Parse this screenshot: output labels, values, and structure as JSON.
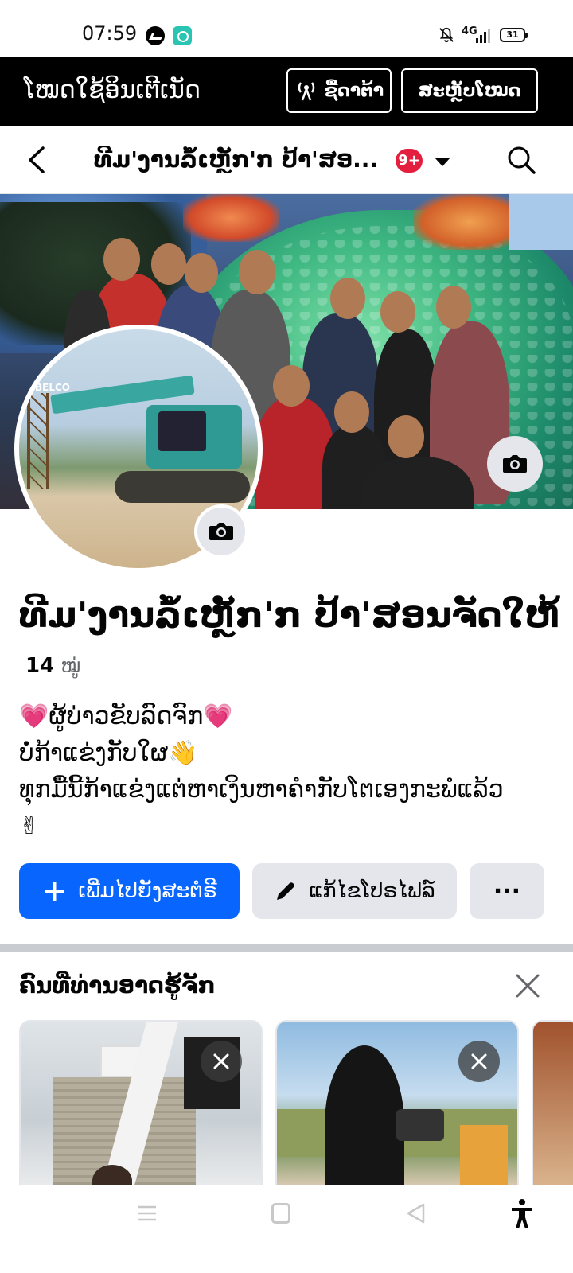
{
  "status_bar": {
    "time": "07:59",
    "network": "4G",
    "battery": "31",
    "icons": [
      "messenger-icon",
      "app-icon",
      "mute-icon",
      "signal-icon",
      "battery-icon"
    ]
  },
  "data_banner": {
    "title": "ໂໝດໃຊ້ອິນເຕີເນັດ",
    "buy_data_label": "ຊື້ດາຕ້າ",
    "switch_mode_label": "ສະຫຼັບໂໝດ"
  },
  "header": {
    "title": "ທີມ'ງານລໍ້ເຫຼັກ'ກ ປ້າ'ສອ...",
    "notification_badge": "9+",
    "icons": [
      "back-icon",
      "caret-down-icon",
      "search-icon"
    ]
  },
  "profile": {
    "name": "ທີມ'ງານລໍ້ເຫຼັກ'ກ ປ້າ'ສອນຈັດໃຫ້",
    "member_count": "14",
    "member_unit": "ໝູ່",
    "bio_lines": [
      "💗ຜູ້ບ່າວຂັບລົດຈົກ💗",
      "ບໍ່ກ້າແຂ່ງກັບໃຜ👋",
      "ທຸກມື້ນີ້ກ້າແຂ່ງແຕ່ຫາເງິນຫາຄຳກັບໂຕເອງກະພໍແລ້ວ",
      "✌"
    ],
    "excavator_brand": "BELCO"
  },
  "actions": {
    "add_story_label": "ເພີ່ມໄປຍັງສະຕໍຣີ",
    "edit_profile_label": "ແກ້ໄຂໂປຣໄຟລ໌",
    "more_label": "···"
  },
  "people_you_may_know": {
    "title": "ຄົນທີ່ທ່ານອາດຮູ້ຈັກ"
  },
  "colors": {
    "accent_blue": "#0866ff",
    "badge_red": "#e41e3f",
    "banner_black": "#000000",
    "button_gray": "#e4e6eb"
  }
}
